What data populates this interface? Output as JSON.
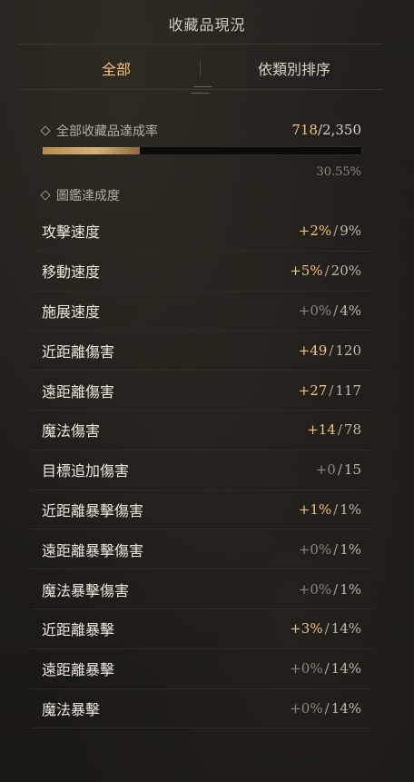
{
  "header": {
    "title": "收藏品現況"
  },
  "tabs": [
    {
      "label": "全部",
      "active": true
    },
    {
      "label": "依類別排序",
      "active": false
    }
  ],
  "collection_rate": {
    "label": "全部收藏品達成率",
    "current": "718",
    "separator": "/",
    "total": "2,350",
    "percent_text": "30.55%",
    "progress": 0.3055
  },
  "codex": {
    "label": "圖鑑達成度"
  },
  "stats": [
    {
      "name": "攻擊速度",
      "current": "+2%",
      "max": "9%",
      "highlight": true
    },
    {
      "name": "移動速度",
      "current": "+5%",
      "max": "20%",
      "highlight": true
    },
    {
      "name": "施展速度",
      "current": "+0%",
      "max": "4%",
      "highlight": false
    },
    {
      "name": "近距離傷害",
      "current": "+49",
      "max": "120",
      "highlight": true
    },
    {
      "name": "遠距離傷害",
      "current": "+27",
      "max": "117",
      "highlight": true
    },
    {
      "name": "魔法傷害",
      "current": "+14",
      "max": "78",
      "highlight": true
    },
    {
      "name": "目標追加傷害",
      "current": "+0",
      "max": "15",
      "highlight": false
    },
    {
      "name": "近距離暴擊傷害",
      "current": "+1%",
      "max": "1%",
      "highlight": true
    },
    {
      "name": "遠距離暴擊傷害",
      "current": "+0%",
      "max": "1%",
      "highlight": false
    },
    {
      "name": "魔法暴擊傷害",
      "current": "+0%",
      "max": "1%",
      "highlight": false
    },
    {
      "name": "近距離暴擊",
      "current": "+3%",
      "max": "14%",
      "highlight": true
    },
    {
      "name": "遠距離暴擊",
      "current": "+0%",
      "max": "14%",
      "highlight": false
    },
    {
      "name": "魔法暴擊",
      "current": "+0%",
      "max": "14%",
      "highlight": false
    }
  ],
  "colors": {
    "accent": "#f0c27a",
    "dim": "#8c877e",
    "background": "#1c1a17"
  }
}
